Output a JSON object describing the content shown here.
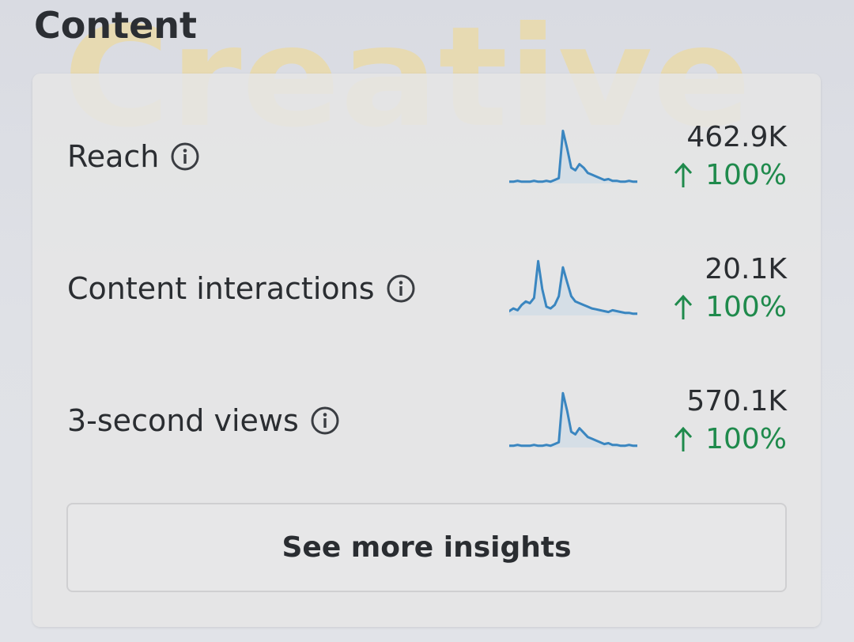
{
  "section": {
    "title": "Content"
  },
  "watermark": {
    "text": "Creative",
    "color": "#f3d98a"
  },
  "metrics": [
    {
      "label": "Reach",
      "value": "462.9K",
      "change": "100%",
      "change_direction": "up",
      "info_icon": "info-circle-icon",
      "sparkline": [
        2,
        2,
        3,
        2,
        2,
        2,
        3,
        2,
        2,
        3,
        2,
        4,
        6,
        60,
        40,
        18,
        15,
        22,
        18,
        12,
        10,
        8,
        6,
        4,
        5,
        3,
        3,
        2,
        2,
        3,
        2,
        2
      ]
    },
    {
      "label": "Content interactions",
      "value": "20.1K",
      "change": "100%",
      "change_direction": "up",
      "info_icon": "info-circle-icon",
      "sparkline": [
        5,
        8,
        6,
        12,
        16,
        14,
        20,
        62,
        30,
        10,
        8,
        12,
        22,
        55,
        38,
        22,
        16,
        14,
        12,
        10,
        8,
        7,
        6,
        5,
        4,
        6,
        5,
        4,
        3,
        3,
        2,
        2
      ]
    },
    {
      "label": "3-second views",
      "value": "570.1K",
      "change": "100%",
      "change_direction": "up",
      "info_icon": "info-circle-icon",
      "sparkline": [
        2,
        2,
        3,
        2,
        2,
        2,
        3,
        2,
        2,
        3,
        2,
        4,
        6,
        62,
        42,
        18,
        15,
        22,
        17,
        12,
        10,
        8,
        6,
        4,
        5,
        3,
        3,
        2,
        2,
        3,
        2,
        2
      ]
    }
  ],
  "button": {
    "label": "See more insights"
  },
  "colors": {
    "sparkline_stroke": "#3a86c0",
    "sparkline_fill": "#c9d8e6",
    "positive_change": "#1f8a4c",
    "text": "#2a2d31"
  }
}
